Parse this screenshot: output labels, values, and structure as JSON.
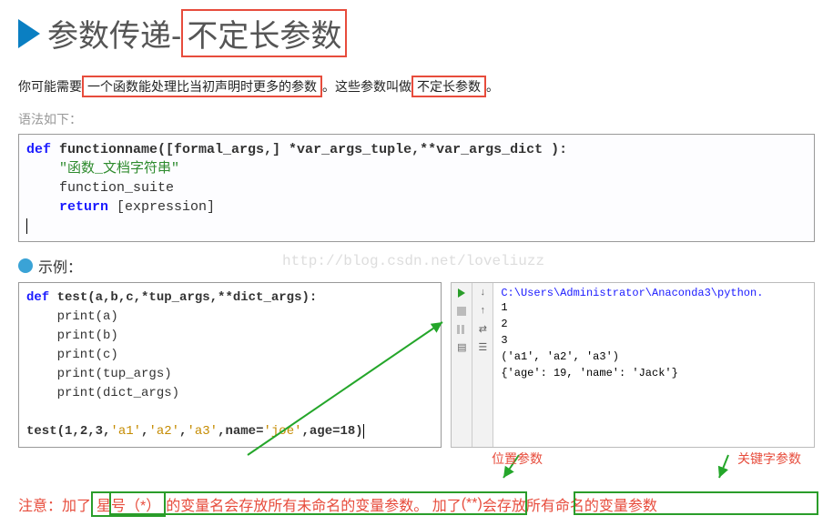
{
  "title": {
    "part1": "参数传递-",
    "part2": "不定长参数"
  },
  "para": {
    "p1a": "你可能需要",
    "p1b": "一个函数能处理比当初声明时更多的参数",
    "p1c": "。这些参数叫做",
    "p1d": "不定长参数",
    "p1e": "。"
  },
  "syntaxLabel": "语法如下：",
  "syntax": {
    "l1a": "def",
    "l1b": " functionname([formal_args,] *var_args_tuple,**var_args_dict ):",
    "l2": "    \"函数_文档字符串\"",
    "l3": "    function_suite",
    "l4a": "    ",
    "l4b": "return",
    "l4c": " [expression]"
  },
  "exampleLabel": "示例：",
  "code2": {
    "l1a": "def",
    "l1b": " test(a,b,c,*tup_args,**dict_args):",
    "l2": "    print(a)",
    "l3": "    print(b)",
    "l4": "    print(c)",
    "l5": "    print(tup_args)",
    "l6": "    print(dict_args)",
    "l7": "",
    "l8a": "test",
    "l8b": "(1,2,3,",
    "l8c": "'a1'",
    "l8d": ",",
    "l8e": "'a2'",
    "l8f": ",",
    "l8g": "'a3'",
    "l8h": ",name=",
    "l8i": "'joe'",
    "l8j": ",age=18)"
  },
  "console": {
    "path": "C:\\Users\\Administrator\\Anaconda3\\python.",
    "out1": "1",
    "out2": "2",
    "out3": "3",
    "out4": "('a1', 'a2', 'a3')",
    "out5": "{'age': 19, 'name': 'Jack'}"
  },
  "annotations": {
    "pos": "位置参数",
    "kw": "关键字参数"
  },
  "footer": {
    "a": "注意：加了",
    "b": "星号（*）",
    "c": "的变量名会存放所有未命名的变量参数",
    "d": "。 加了",
    "e": "(**)",
    "f": "会存放所有命名的变量参数"
  },
  "watermark": "http://blog.csdn.net/loveliuzz"
}
